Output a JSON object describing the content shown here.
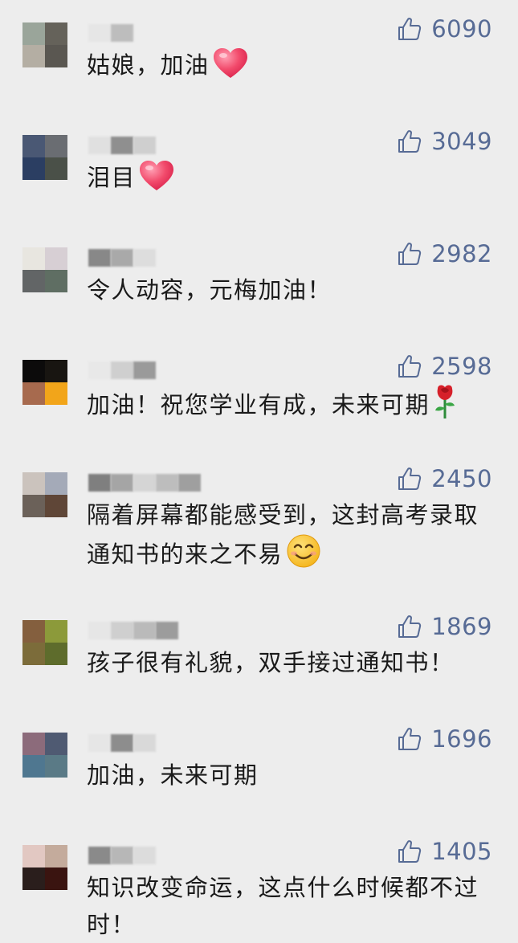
{
  "comments": [
    {
      "likes": "6090",
      "text": "姑娘，加油",
      "emoji": "heart-emoji",
      "avatar": [
        "#9aa59a",
        "#65625a",
        "#b4aea3",
        "#5a5751"
      ],
      "name_pixels": [
        "#e6e6e6",
        "#bdbdbd"
      ]
    },
    {
      "likes": "3049",
      "text": "泪目",
      "emoji": "heart-emoji",
      "avatar": [
        "#4a5874",
        "#6a6d72",
        "#2b3e62",
        "#4a5048"
      ],
      "name_pixels": [
        "#e0e0e0",
        "#8f8f8f",
        "#cfcfcf"
      ]
    },
    {
      "likes": "2982",
      "text": "令人动容，元梅加油！",
      "emoji": "",
      "avatar": [
        "#e8e6e0",
        "#d7cfd4",
        "#626566",
        "#5f6e63"
      ],
      "name_pixels": [
        "#888888",
        "#a9a9a9",
        "#dddddd"
      ]
    },
    {
      "likes": "2598",
      "text": "加油！祝您学业有成，未来可期",
      "emoji": "rose-emoji",
      "avatar": [
        "#0c0b0b",
        "#181511",
        "#a76a4e",
        "#f2a51a"
      ],
      "name_pixels": [
        "#e8e8e8",
        "#cfcfcf",
        "#9a9a9a"
      ]
    },
    {
      "likes": "2450",
      "text": "隔着屏幕都能感受到，这封高考录取通知书的来之不易",
      "emoji": "smile-emoji",
      "avatar": [
        "#cbc3bd",
        "#a4aab8",
        "#6b6159",
        "#5f4637"
      ],
      "name_pixels": [
        "#7f7f7f",
        "#a5a5a5",
        "#d5d5d5",
        "#bdbdbd",
        "#9f9f9f"
      ]
    },
    {
      "likes": "1869",
      "text": "孩子很有礼貌，双手接过通知书！",
      "emoji": "",
      "avatar": [
        "#845f3e",
        "#8c9a3a",
        "#7c6c3a",
        "#5e6c2c"
      ],
      "name_pixels": [
        "#e6e6e6",
        "#cfcfcf",
        "#bababa",
        "#9c9c9c"
      ]
    },
    {
      "likes": "1696",
      "text": "加油，未来可期",
      "emoji": "",
      "avatar": [
        "#8c6b7b",
        "#4f5a72",
        "#4f7790",
        "#5a7a86"
      ],
      "name_pixels": [
        "#e6e6e6",
        "#8d8d8d",
        "#d9d9d9"
      ]
    },
    {
      "likes": "1405",
      "text": "知识改变命运，这点什么时候都不过时！",
      "emoji": "",
      "avatar": [
        "#e2c8c2",
        "#c4ab9c",
        "#2a1e1c",
        "#3a1410"
      ],
      "name_pixels": [
        "#8a8a8a",
        "#b7b7b7",
        "#dcdcdc"
      ]
    }
  ]
}
